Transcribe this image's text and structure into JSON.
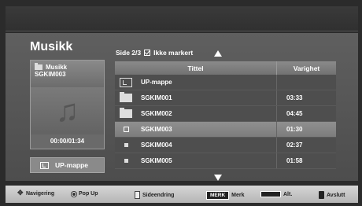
{
  "header": {
    "title": "Musikk",
    "page_indicator": "Side 2/3",
    "mark_status": "Ikke markert"
  },
  "preview": {
    "folder_label": "Musikk",
    "file_name": "SGKIM003",
    "time": "00:00/01:34",
    "art_icon": "music-note-icon"
  },
  "up_button": {
    "label": "UP-mappe"
  },
  "list": {
    "headers": {
      "title": "Tittel",
      "duration": "Varighet"
    },
    "rows": [
      {
        "name": "UP-mappe",
        "duration": "",
        "type": "up-folder"
      },
      {
        "name": "SGKIM001",
        "duration": "03:33",
        "type": "folder"
      },
      {
        "name": "SGKIM002",
        "duration": "04:45",
        "type": "folder"
      },
      {
        "name": "SGKIM003",
        "duration": "01:30",
        "type": "file",
        "selected": true
      },
      {
        "name": "SGKIM004",
        "duration": "02:37",
        "type": "file"
      },
      {
        "name": "SGKIM005",
        "duration": "01:58",
        "type": "file"
      }
    ]
  },
  "footer": {
    "navigation": "Navigering",
    "popup": "Pop Up",
    "page_change": "Sideendring",
    "mark_key": "MERK",
    "mark": "Merk",
    "alt": "Alt.",
    "exit": "Avslutt"
  }
}
